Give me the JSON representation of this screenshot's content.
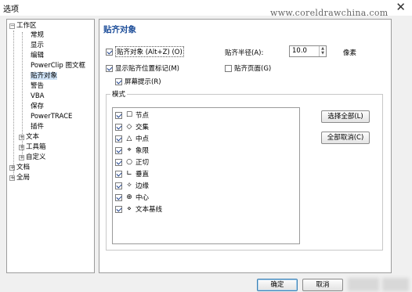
{
  "window": {
    "title": "选项",
    "close_glyph": "✕"
  },
  "watermark": "www.coreldrawchina.com",
  "tree": {
    "root_expand": "−",
    "root": "工作区",
    "children": [
      "常规",
      "显示",
      "编辑",
      "PowerClip 图文框",
      "贴齐对象",
      "警告",
      "VBA",
      "保存",
      "PowerTRACE",
      "插件"
    ],
    "collapsed_children": [
      "文本",
      "工具箱",
      "自定义"
    ],
    "top_level": [
      "文档",
      "全局"
    ],
    "expand_plus": "+"
  },
  "panel": {
    "title": "贴齐对象",
    "snap_checkbox": "贴齐对象 (Alt+Z) (O)",
    "show_marks": "显示贴齐位置标记(M)",
    "screen_tips": "屏幕提示(R)",
    "radius_label": "贴齐半径(A):",
    "radius_value": "10.0",
    "radius_unit": "像素",
    "snap_pages": "贴齐页面(G)",
    "spin_up": "▲",
    "spin_down": "▼",
    "group_title": "模式",
    "modes": [
      {
        "glyph": "☐",
        "label": "节点"
      },
      {
        "glyph": "◇",
        "label": "交集"
      },
      {
        "glyph": "△",
        "label": "中点"
      },
      {
        "glyph": "⌖",
        "label": "象限"
      },
      {
        "glyph": "○",
        "label": "正切"
      },
      {
        "glyph": "∟",
        "label": "垂直"
      },
      {
        "glyph": "✧",
        "label": "边缘"
      },
      {
        "glyph": "⊕",
        "label": "中心"
      },
      {
        "glyph": "⋄",
        "label": "文本基线"
      }
    ],
    "select_all": "选择全部(L)",
    "deselect_all": "全部取消(C)"
  },
  "footer": {
    "ok": "确定",
    "cancel": "取消"
  },
  "colors": {
    "title_blue": "#1f4f9a",
    "selection": "#cfe3f7"
  }
}
